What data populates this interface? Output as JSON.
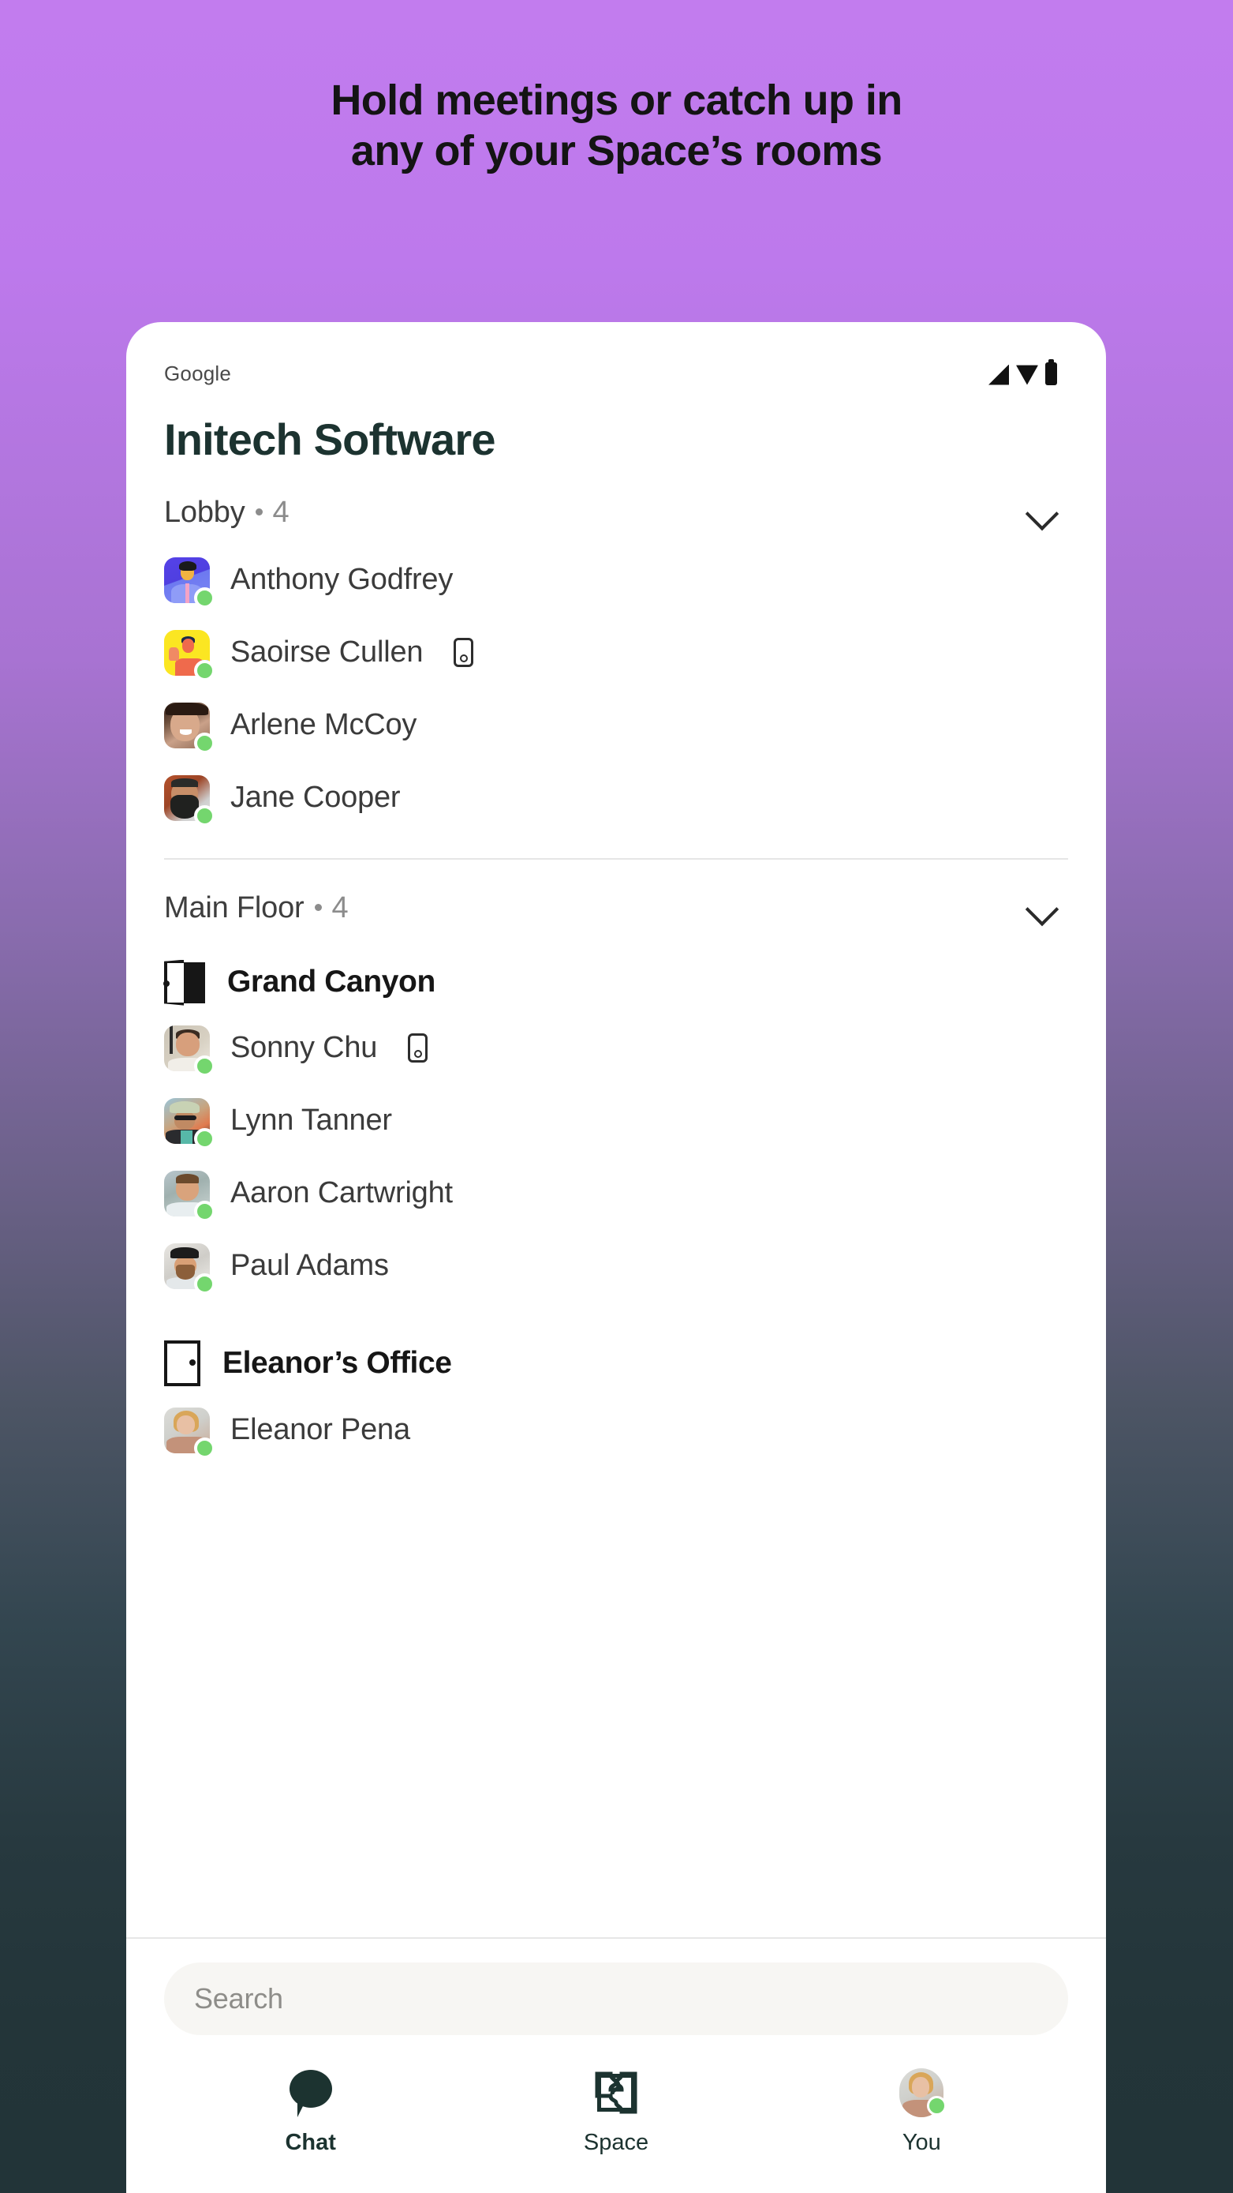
{
  "background": {
    "gradient_top": "#c27cee",
    "gradient_bottom": "#223438"
  },
  "headline": {
    "line1": "Hold meetings or catch up in",
    "line2": "any of your Space’s rooms"
  },
  "phone": {
    "statusbar": {
      "carrier": "Google",
      "icons": [
        "signal-icon",
        "wifi-icon",
        "battery-icon"
      ]
    },
    "space_title": "Initech Software",
    "accent_presence_color": "#74d66e",
    "title_color": "#1c3330",
    "floors": [
      {
        "name": "Lobby",
        "separator": "•",
        "count": "4",
        "collapse_icon": "chevron-down-icon",
        "rooms": [
          {
            "name": "",
            "icon": "",
            "members": [
              {
                "name": "Anthony Godfrey",
                "avatar": "art-anthony",
                "presence": "online",
                "device": ""
              },
              {
                "name": "Saoirse Cullen",
                "avatar": "art-saoirse",
                "presence": "online",
                "device": "mobile-phone-icon"
              },
              {
                "name": "Arlene McCoy",
                "avatar": "art-arlene",
                "presence": "online",
                "device": ""
              },
              {
                "name": "Jane Cooper",
                "avatar": "art-jane",
                "presence": "online",
                "device": ""
              }
            ]
          }
        ]
      },
      {
        "name": "Main Floor",
        "separator": "•",
        "count": "4",
        "collapse_icon": "chevron-down-icon",
        "rooms": [
          {
            "name": "Grand Canyon",
            "icon": "door-open-icon",
            "members": [
              {
                "name": "Sonny Chu",
                "avatar": "art-sonny",
                "presence": "online",
                "device": "mobile-phone-icon"
              },
              {
                "name": "Lynn Tanner",
                "avatar": "art-lynn",
                "presence": "online",
                "device": ""
              },
              {
                "name": "Aaron Cartwright",
                "avatar": "art-aaron",
                "presence": "online",
                "device": ""
              },
              {
                "name": "Paul Adams",
                "avatar": "art-paul",
                "presence": "online",
                "device": ""
              }
            ]
          },
          {
            "name": "Eleanor’s Office",
            "icon": "door-closed-icon",
            "members": [
              {
                "name": "Eleanor Pena",
                "avatar": "art-eleanor",
                "presence": "online",
                "device": ""
              }
            ]
          }
        ]
      }
    ],
    "search": {
      "placeholder": "Search",
      "value": ""
    },
    "navbar": {
      "items": [
        {
          "label": "Chat",
          "icon": "chat-bubble-icon",
          "active": true
        },
        {
          "label": "Space",
          "icon": "space-floorplan-icon",
          "active": false
        },
        {
          "label": "You",
          "icon": "user-avatar-icon",
          "active": false
        }
      ]
    }
  }
}
